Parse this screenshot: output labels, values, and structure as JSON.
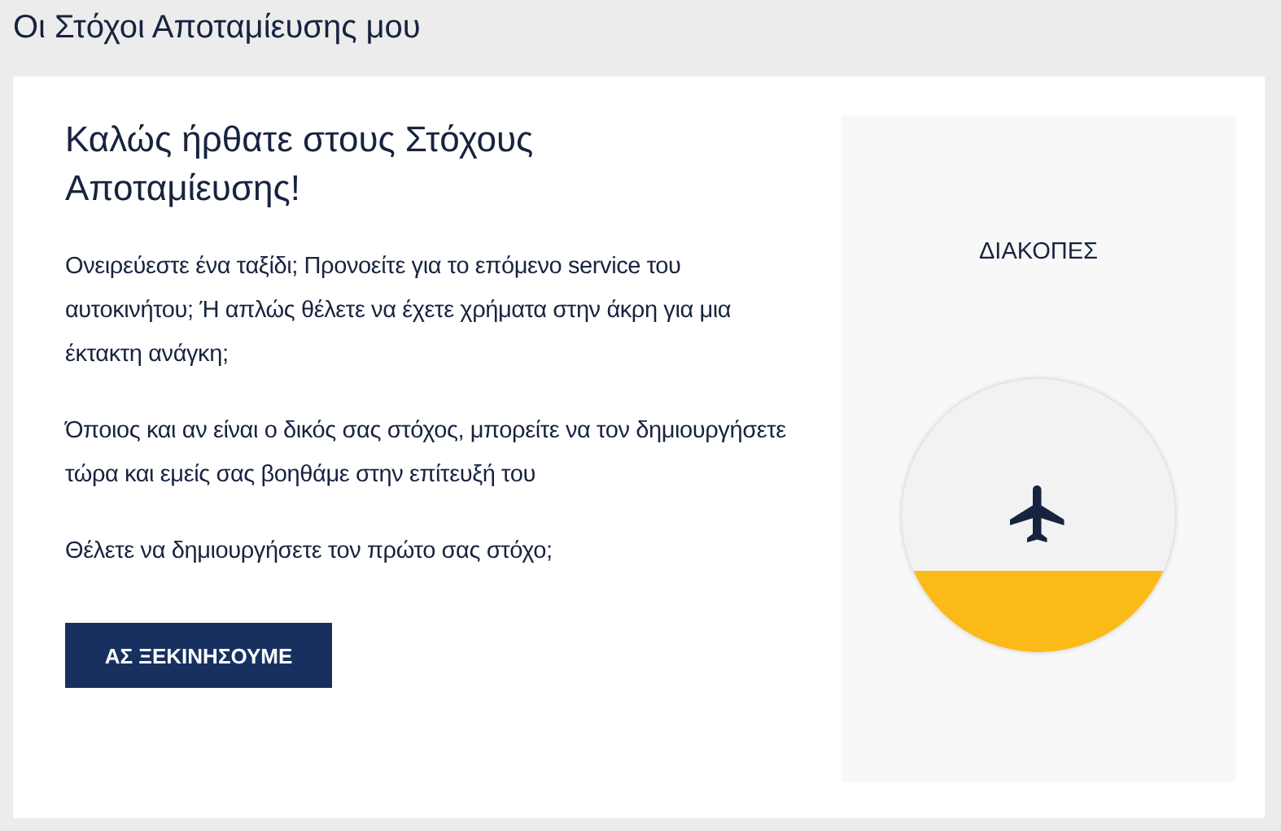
{
  "page_title": "Οι Στόχοι Αποταμίευσης μου",
  "welcome": {
    "heading": "Καλώς ήρθατε στους Στόχους Αποταμίευσης!",
    "paragraphs": [
      "Ονειρεύεστε ένα ταξίδι; Προνοείτε για το επόμενο service του αυτοκινήτου; Ή απλώς θέλετε να έχετε χρήματα στην άκρη για μια έκτακτη ανάγκη;",
      "Όποιος και αν είναι ο δικός σας στόχος, μπορείτε να τον δημιουργήσετε τώρα και εμείς σας βοηθάμε στην επίτευξή του",
      "Θέλετε να δημιουργήσετε τον πρώτο σας στόχο;"
    ],
    "button": "ΑΣ ΞΕΚΙΝΗΣΟΥΜΕ"
  },
  "goal": {
    "title": "ΔΙΑΚΟΠΕΣ"
  }
}
